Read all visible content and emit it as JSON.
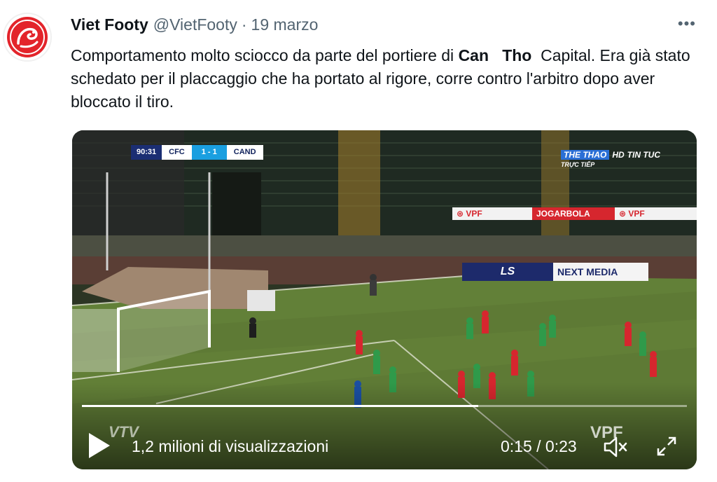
{
  "tweet": {
    "display_name": "Viet Footy",
    "handle": "@VietFooty",
    "separator": "·",
    "date": "19 marzo",
    "more_label": "•••",
    "text_part1": "Comportamento molto sciocco da parte del portiere di ",
    "text_bold1": "Can",
    "text_gap": "   ",
    "text_bold2": "Tho",
    "text_part2": "  Capital. Era già stato schedato per il placcaggio che ha portato al rigore, corre contro l'arbitro dopo aver bloccato il tiro."
  },
  "video": {
    "views": "1,2 milioni di visualizzazioni",
    "time": "0:15 / 0:23",
    "progress": 0.655,
    "scorebug": {
      "clock": "90:31",
      "home": "CFC",
      "score": "1 - 1",
      "away": "CAND"
    },
    "broadcaster": {
      "name": "THE THAO",
      "hd": "HD",
      "news": "TIN TUC",
      "sub": "TRỰC TIẾP"
    },
    "ads": {
      "vpf1": "⊛ VPF",
      "jogarbola": "JOGARBOLA",
      "vpf2": "⊛ VPF",
      "ls": "LS",
      "next_media": "NEXT MEDIA"
    },
    "watermark_left": "VTV",
    "watermark_right": "VPF"
  },
  "colors": {
    "text": "#0f1419",
    "secondary": "#536471",
    "pitch": "#5e7a35",
    "home_kit": "#d6262e",
    "away_kit": "#2f9a4a",
    "accent": "#1a9fe0"
  }
}
